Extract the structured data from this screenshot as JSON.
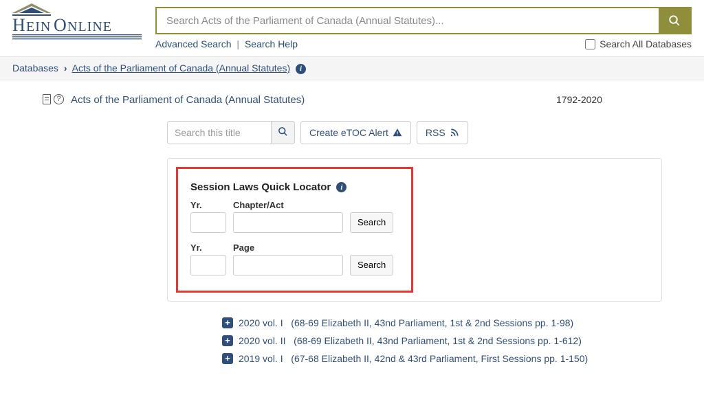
{
  "search": {
    "placeholder": "Search Acts of the Parliament of Canada (Annual Statutes)...",
    "advanced": "Advanced Search",
    "help": "Search Help",
    "all": "Search All Databases"
  },
  "breadcrumb": {
    "root": "Databases",
    "current": "Acts of the Parliament of Canada (Annual Statutes)"
  },
  "title": {
    "text": "Acts of the Parliament of Canada (Annual Statutes)",
    "range": "1792-2020"
  },
  "actions": {
    "titleSearchPlaceholder": "Search this title",
    "etoc": "Create eTOC Alert",
    "rss": "RSS"
  },
  "locator": {
    "heading": "Session Laws Quick Locator",
    "yr": "Yr.",
    "chapter": "Chapter/Act",
    "page": "Page",
    "search": "Search"
  },
  "volumes": [
    {
      "label": "2020 vol. I",
      "desc": "(68-69 Elizabeth II, 43nd Parliament, 1st & 2nd Sessions pp. 1-98)"
    },
    {
      "label": "2020 vol. II",
      "desc": "(68-69 Elizabeth II, 43nd Parliament, 1st & 2nd Sessions pp. 1-612)"
    },
    {
      "label": "2019 vol. I",
      "desc": "(67-68 Elizabeth II, 42nd & 43rd Parliament, First Sessions pp. 1-150)"
    }
  ]
}
